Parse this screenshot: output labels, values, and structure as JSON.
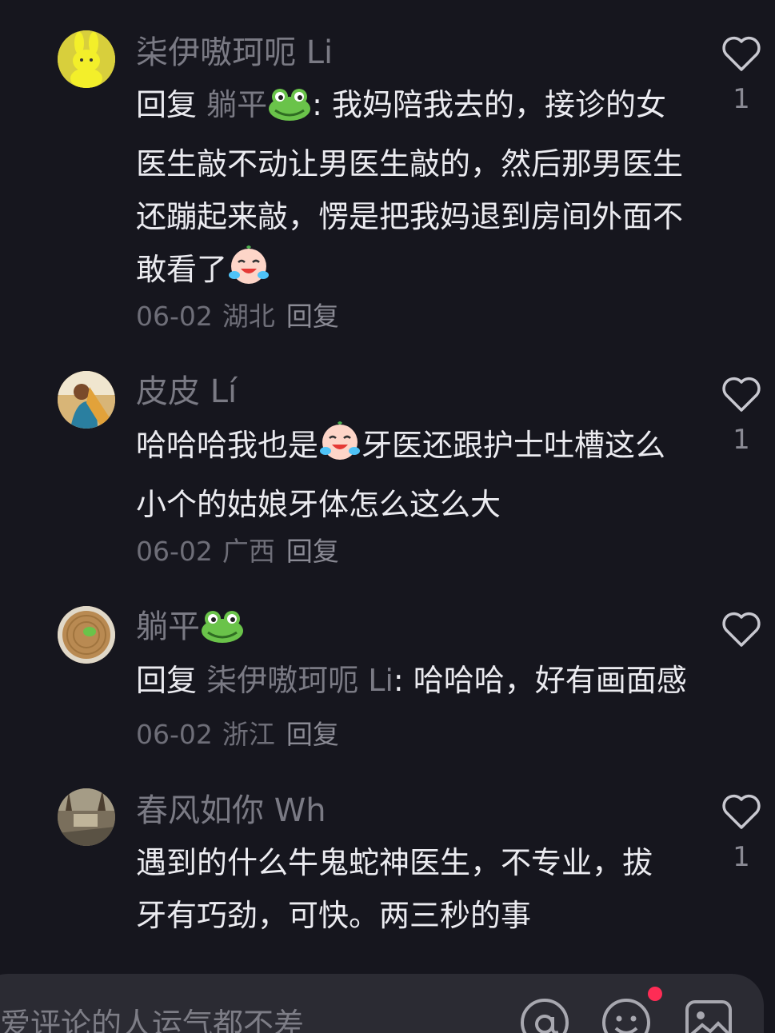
{
  "comments": [
    {
      "username": "柒伊嗷珂呃 Li",
      "reply_prefix": "回复",
      "reply_target": "躺平",
      "reply_target_emoji": "frog-emoji",
      "text": ": 我妈陪我去的，接诊的女医生敲不动让男医生敲的，然后那男医生还蹦起来敲，愣是把我妈退到房间外面不敢看了",
      "trailing_emoji": "crying-laughing-emoji",
      "date": "06-02",
      "region": "湖北",
      "reply_label": "回复",
      "likes": "1"
    },
    {
      "username": "皮皮 Lí",
      "text_before_emoji": "哈哈哈我也是",
      "inline_emoji": "crying-laughing-emoji",
      "text_after_emoji": "牙医还跟护士吐槽这么小个的姑娘牙体怎么这么大",
      "date": "06-02",
      "region": "广西",
      "reply_label": "回复",
      "likes": "1"
    },
    {
      "username": "躺平",
      "username_emoji": "frog-emoji",
      "reply_prefix": "回复",
      "reply_target": "柒伊嗷珂呃 Li",
      "text": ": 哈哈哈，好有画面感",
      "date": "06-02",
      "region": "浙江",
      "reply_label": "回复",
      "likes": ""
    },
    {
      "username": "春风如你 Wh",
      "text": "遇到的什么牛鬼蛇神医生，不专业，拔牙有巧劲，可快。两三秒的事",
      "likes": "1"
    }
  ],
  "input_bar": {
    "placeholder": "爱评论的人运气都不差",
    "icons": [
      "at-icon",
      "emoji-icon",
      "image-icon"
    ],
    "notification_dot_color": "#fe2c55"
  },
  "colors": {
    "background": "#16161e",
    "primary_text": "#ebebf0",
    "secondary_text": "#7a7a84"
  }
}
